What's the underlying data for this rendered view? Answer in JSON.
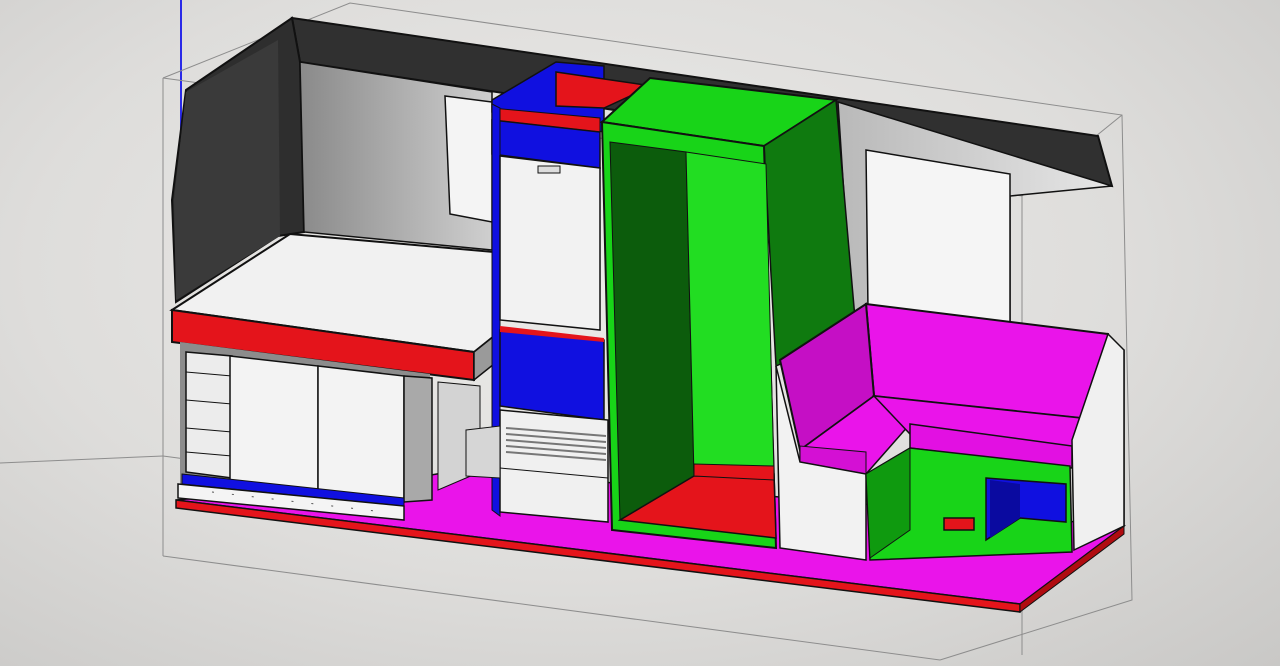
{
  "view": {
    "kind": "3d-model-viewport",
    "subject": "campervan-interior-layout"
  },
  "colors": {
    "background": "#e4e3e1",
    "red": "#e4141b",
    "blue": "#1010e0",
    "green": "#18d418",
    "dark_green": "#0c5c0c",
    "magenta": "#ea14ea",
    "white": "#f2f2f2",
    "grey": "#7f7f7f",
    "dark_grey": "#2a2a2a",
    "outline": "#111111",
    "axis_blue": "#2a2ae8"
  },
  "model_parts": [
    "van-shell",
    "bed-platform",
    "storage-cabinets",
    "fridge-cabinet",
    "wardrobe",
    "l-shaped-bench",
    "floor"
  ]
}
